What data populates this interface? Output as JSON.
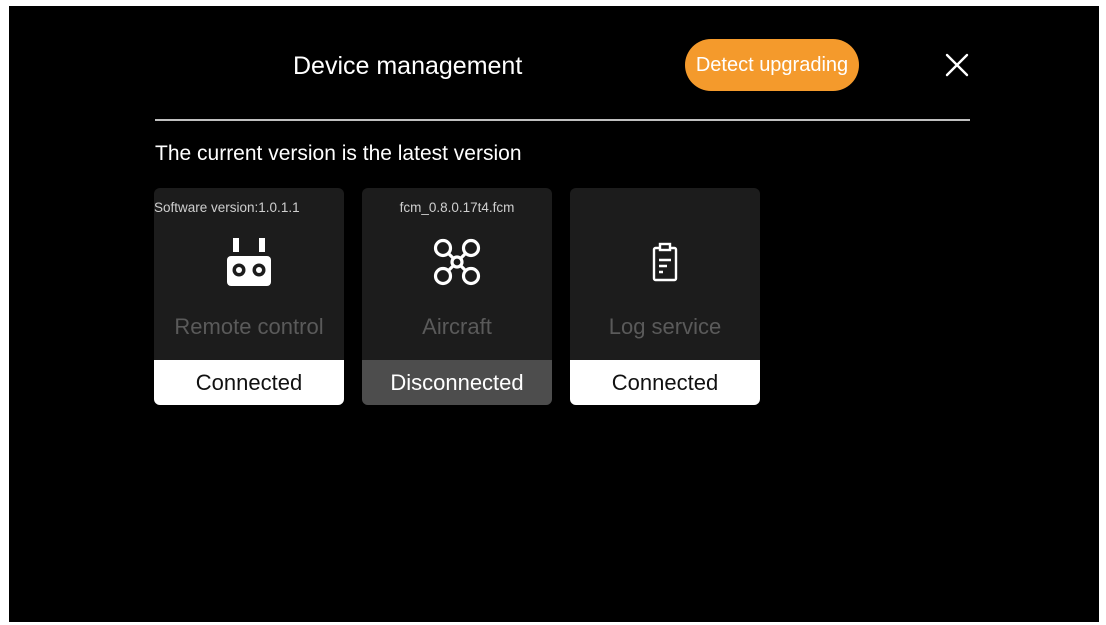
{
  "header": {
    "title": "Device management",
    "detect_label": "Detect upgrading",
    "accent_color": "#f49a2c"
  },
  "status": {
    "message": "The current version is the latest version"
  },
  "devices": [
    {
      "version": "Software version:1.0.1.1",
      "icon": "remote-control-icon",
      "name": "Remote control",
      "state": "Connected"
    },
    {
      "version": "fcm_0.8.0.17t4.fcm",
      "icon": "drone-icon",
      "name": "Aircraft",
      "state": "Disconnected"
    },
    {
      "version": "",
      "icon": "clipboard-icon",
      "name": "Log service",
      "state": "Connected"
    }
  ]
}
